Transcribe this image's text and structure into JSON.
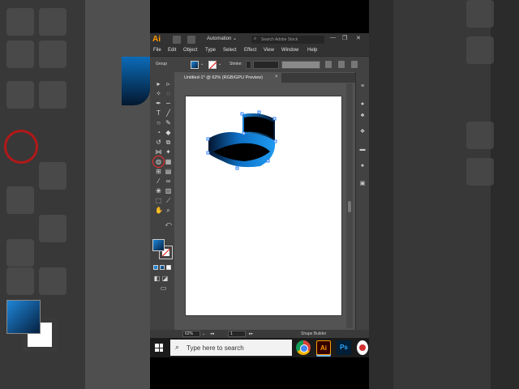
{
  "app": {
    "logo": "Ai",
    "workspace": "Automation",
    "stock_search_placeholder": "Search Adobe Stock",
    "window_controls": [
      "—",
      "❐",
      "✕"
    ]
  },
  "menu": [
    "File",
    "Edit",
    "Object",
    "Type",
    "Select",
    "Effect",
    "View",
    "Window",
    "Help"
  ],
  "control_bar": {
    "selection_label": "Group",
    "stroke_label": "Stroke:"
  },
  "document_tab": {
    "title": "Untitled-1* @ 62% (RGB/GPU Preview)",
    "close": "×"
  },
  "status_bar": {
    "zoom": "62%",
    "artboard": "1",
    "active_tool": "Shape Builder"
  },
  "colors": {
    "accent": "#ff9a00",
    "gradient_light": "#1e86d8",
    "gradient_dark": "#062040",
    "highlight_ring": "#b21818"
  },
  "taskbar": {
    "search_placeholder": "Type here to search",
    "apps": [
      "chrome-icon",
      "illustrator-icon",
      "photoshop-icon",
      "screen-recorder-icon"
    ],
    "ai_label": "Ai",
    "ps_label": "Ps"
  }
}
